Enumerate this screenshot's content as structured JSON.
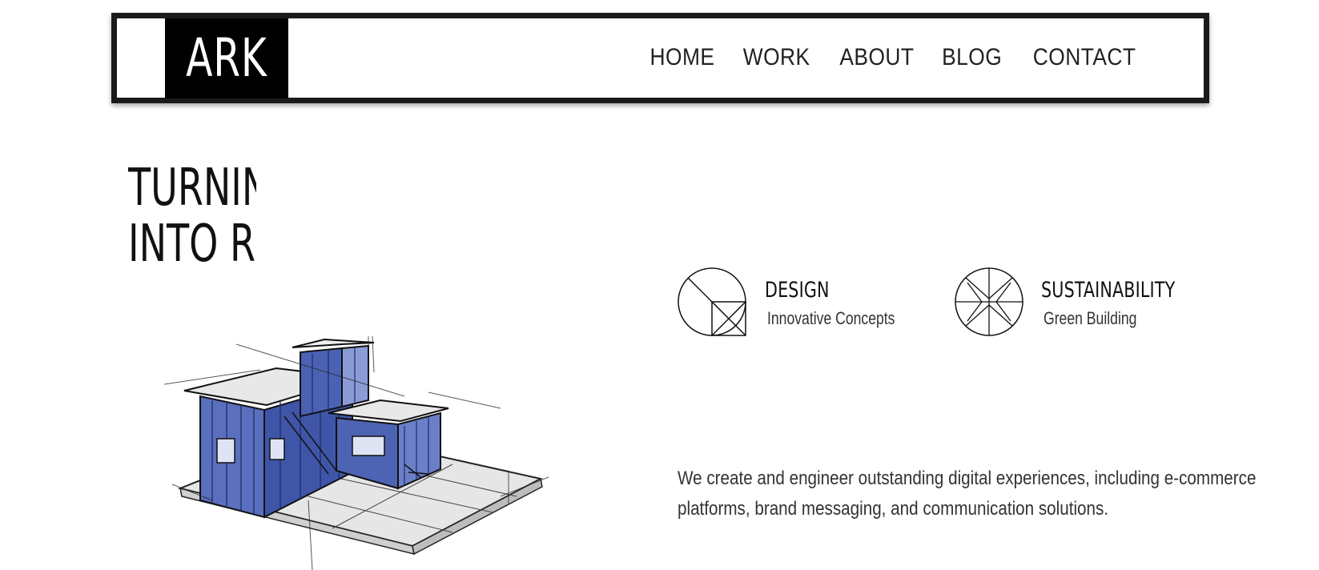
{
  "logo": {
    "text": "ARK"
  },
  "nav": {
    "items": [
      {
        "label": "HOME"
      },
      {
        "label": "WORK"
      },
      {
        "label": "ABOUT"
      },
      {
        "label": "BLOG"
      },
      {
        "label": "CONTACT"
      }
    ]
  },
  "hero": {
    "line1": "TURNING",
    "line2": "INTO RE",
    "image_icon": "building-sketch-illustration"
  },
  "features": [
    {
      "title": "DESIGN",
      "subtitle": "Innovative Concepts",
      "icon": "design-circle-square-icon"
    },
    {
      "title": "SUSTAINABILITY",
      "subtitle": "Green Building",
      "icon": "sustainability-spokes-icon"
    }
  ],
  "description": {
    "line1": "We create and engineer outstanding digital experiences, including e-commerce",
    "line2": "platforms, brand messaging, and communication solutions."
  },
  "colors": {
    "frame": "#1a1a1a",
    "logo_bg": "#000000",
    "building_blue": "#4f66b8"
  }
}
